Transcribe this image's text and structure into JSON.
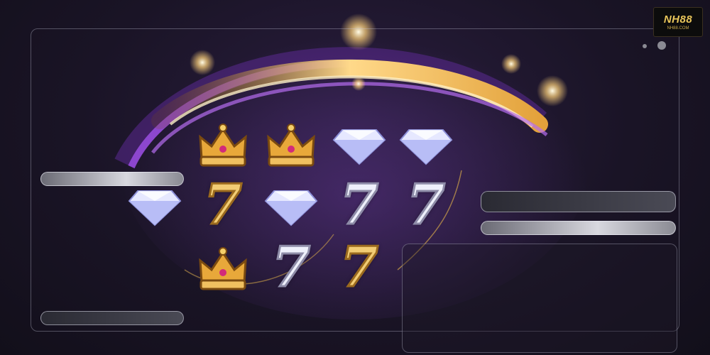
{
  "logo": {
    "main": "NH88",
    "sub": "NH88.COM"
  },
  "colors": {
    "gold": "#e8b84a",
    "purple": "#8a3fd1",
    "background": "#1a1426"
  },
  "reels": {
    "rows": [
      {
        "symbols": [
          "crown-icon",
          "crown-icon",
          "diamond-icon",
          "diamond-icon"
        ]
      },
      {
        "symbols": [
          "diamond-icon",
          "seven-gold-icon",
          "diamond-icon",
          "seven-silver-icon",
          "seven-silver-icon"
        ]
      },
      {
        "symbols": [
          "crown-icon",
          "seven-silver-icon",
          "seven-gold-icon"
        ]
      }
    ],
    "seven_text": "7"
  }
}
